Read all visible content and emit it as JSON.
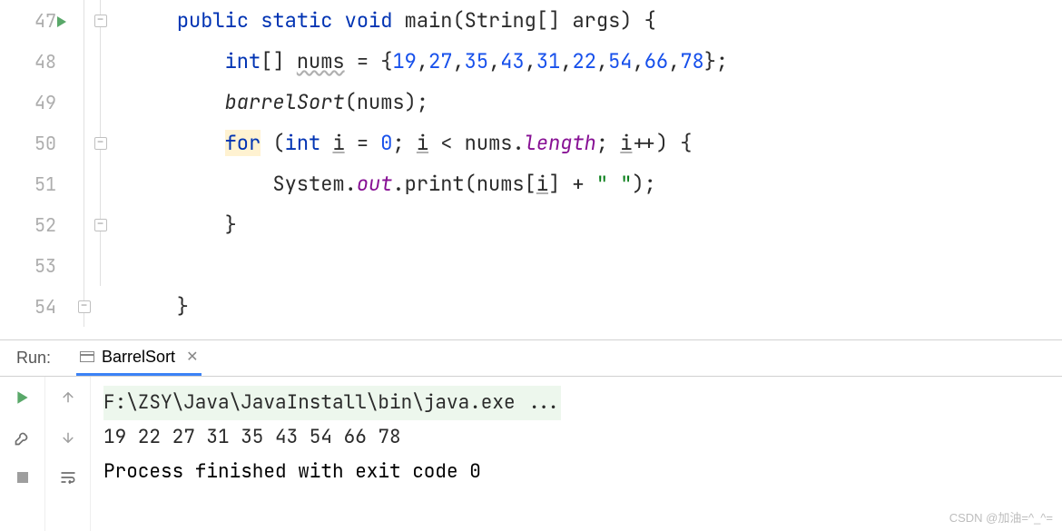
{
  "editor": {
    "line_numbers": [
      "47",
      "48",
      "49",
      "50",
      "51",
      "52",
      "53",
      "54",
      ""
    ],
    "tokens": {
      "l47": [
        "    ",
        "public",
        " ",
        "static",
        " ",
        "void",
        " ",
        "main",
        "(",
        "String",
        "[] ",
        "args",
        ") {"
      ],
      "l48": [
        "        ",
        "int",
        "[] ",
        "nums",
        " = {",
        "19",
        ",",
        "27",
        ",",
        "35",
        ",",
        "43",
        ",",
        "31",
        ",",
        "22",
        ",",
        "54",
        ",",
        "66",
        ",",
        "78",
        "};"
      ],
      "l49": [
        "        ",
        "barrelSort",
        "(nums);"
      ],
      "l50": [
        "        ",
        "for",
        " (",
        "int",
        " ",
        "i",
        " = ",
        "0",
        "; ",
        "i",
        " < nums.",
        "length",
        "; ",
        "i",
        "++) {"
      ],
      "l51": [
        "            System.",
        "out",
        ".print(nums[",
        "i",
        "] + ",
        "\" \"",
        ");"
      ],
      "l52": [
        "        }"
      ],
      "l53": [
        ""
      ],
      "l54": [
        "    }"
      ]
    }
  },
  "run": {
    "label": "Run:",
    "tab": "BarrelSort",
    "console": {
      "cmd": "F:\\ZSY\\Java\\JavaInstall\\bin\\java.exe ...",
      "output": "19 22 27 31 35 43 54 66 78 ",
      "exit": "Process finished with exit code 0"
    }
  },
  "watermark": "CSDN @加油=^_^="
}
